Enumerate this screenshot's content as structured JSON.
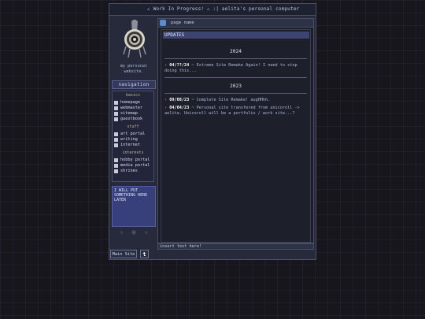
{
  "marquee": "⚠ Work In Progress! ⚠ :| aelita's personal computer",
  "sidebar": {
    "tagline": "my personal website.",
    "nav_title": "navigation",
    "sections": [
      {
        "title": "basics",
        "items": [
          {
            "label": "homepage",
            "icon": "house-icon"
          },
          {
            "label": "webmaster",
            "icon": "person-icon"
          },
          {
            "label": "sitemap",
            "icon": "map-icon"
          },
          {
            "label": "guestbook",
            "icon": "book-icon"
          }
        ]
      },
      {
        "title": "stuff",
        "items": [
          {
            "label": "art portal",
            "icon": "palette-icon"
          },
          {
            "label": "writing",
            "icon": "pencil-icon"
          },
          {
            "label": "internet",
            "icon": "globe-icon"
          }
        ]
      },
      {
        "title": "interests",
        "items": [
          {
            "label": "hobby portal",
            "icon": "star-icon"
          },
          {
            "label": "media portal",
            "icon": "film-icon"
          },
          {
            "label": "shrines",
            "icon": "shrine-icon"
          }
        ]
      }
    ],
    "note": "I WILL PUT SOMETHING HERE LATER",
    "stars": "☆ ◎ ☆"
  },
  "address": {
    "page_name": "page name"
  },
  "updates": {
    "heading": "UPDATES",
    "groups": [
      {
        "year": "2024",
        "entries": [
          {
            "date": "04/??/24",
            "text": " ~ Extreme Site Remake Again! I need to stop doing this..."
          }
        ]
      },
      {
        "year": "2023",
        "entries": [
          {
            "date": "09/08/23",
            "text": " ~ Complete Site Remake! augHHhh."
          },
          {
            "date": "04/04/23",
            "text": " ~ Personal site transfered from unicoroll -> aelita. Unicoroll will be a portfolio / work site...?"
          }
        ]
      }
    ]
  },
  "status_bar": "insert text here!",
  "bottom": {
    "main_site": "Main Site",
    "tumblr": "t"
  },
  "colors": {
    "accent": "#3c4470",
    "background": "#16161c"
  }
}
